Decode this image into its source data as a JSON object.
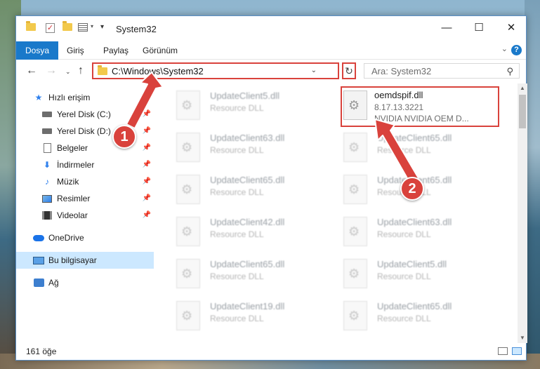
{
  "window": {
    "title": "System32"
  },
  "ribbon": {
    "tabs": [
      "Dosya",
      "Giriş",
      "Paylaş",
      "Görünüm"
    ]
  },
  "nav": {
    "address": "C:\\Windows\\System32",
    "search_placeholder": "Ara: System32"
  },
  "sidebar": {
    "items": [
      {
        "label": "Hızlı erişim",
        "icon": "star-icon"
      },
      {
        "label": "Yerel Disk (C:)",
        "icon": "drive-icon"
      },
      {
        "label": "Yerel Disk (D:)",
        "icon": "drive-icon"
      },
      {
        "label": "Belgeler",
        "icon": "document-icon"
      },
      {
        "label": "İndirmeler",
        "icon": "download-icon"
      },
      {
        "label": "Müzik",
        "icon": "music-icon"
      },
      {
        "label": "Resimler",
        "icon": "pictures-icon"
      },
      {
        "label": "Videolar",
        "icon": "video-icon"
      },
      {
        "label": "OneDrive",
        "icon": "cloud-icon"
      },
      {
        "label": "Bu bilgisayar",
        "icon": "computer-icon"
      },
      {
        "label": "Ağ",
        "icon": "network-icon"
      }
    ]
  },
  "files": {
    "left": [
      {
        "name": "UpdateClient5.dll",
        "desc": "Resource DLL"
      },
      {
        "name": "UpdateClient63.dll",
        "desc": "Resource DLL"
      },
      {
        "name": "UpdateClient65.dll",
        "desc": "Resource DLL"
      },
      {
        "name": "UpdateClient42.dll",
        "desc": "Resource DLL"
      },
      {
        "name": "UpdateClient65.dll",
        "desc": "Resource DLL"
      },
      {
        "name": "UpdateClient19.dll",
        "desc": "Resource DLL"
      }
    ],
    "right": [
      {
        "name": "UpdateClient65.dll",
        "desc": "Resource DLL"
      },
      {
        "name": "UpdateClient65.dll",
        "desc": "Resource DLL"
      },
      {
        "name": "UpdateClient63.dll",
        "desc": "Resource DLL"
      },
      {
        "name": "UpdateClient5.dll",
        "desc": "Resource DLL"
      },
      {
        "name": "UpdateClient65.dll",
        "desc": "Resource DLL"
      }
    ],
    "target": {
      "name": "oemdspif.dll",
      "version": "8.17.13.3221",
      "desc": "NVIDIA NVIDIA OEM D..."
    }
  },
  "status": {
    "count": "161 öğe"
  },
  "annotations": {
    "badge1": "1",
    "badge2": "2",
    "color": "#d9423c"
  }
}
